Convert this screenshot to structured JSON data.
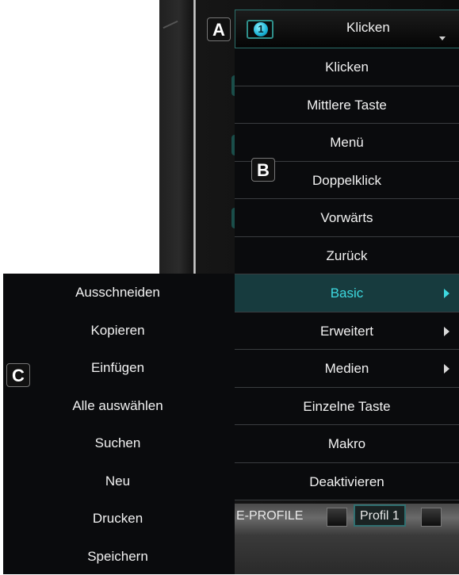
{
  "callouts": {
    "a": "A",
    "b": "B",
    "c": "C"
  },
  "dropdown": {
    "badge": "1",
    "selected_value": "Klicken",
    "items": [
      {
        "label": "Klicken",
        "has_submenu": false
      },
      {
        "label": "Mittlere Taste",
        "has_submenu": false
      },
      {
        "label": "Menü",
        "has_submenu": false
      },
      {
        "label": "Doppelklick",
        "has_submenu": false
      },
      {
        "label": "Vorwärts",
        "has_submenu": false
      },
      {
        "label": "Zurück",
        "has_submenu": false
      },
      {
        "label": "Basic",
        "has_submenu": true,
        "active": true
      },
      {
        "label": "Erweitert",
        "has_submenu": true
      },
      {
        "label": "Medien",
        "has_submenu": true
      },
      {
        "label": "Einzelne Taste",
        "has_submenu": false
      },
      {
        "label": "Makro",
        "has_submenu": false
      },
      {
        "label": "Deaktivieren",
        "has_submenu": false
      }
    ]
  },
  "submenu": {
    "items": [
      {
        "label": "Ausschneiden"
      },
      {
        "label": "Kopieren"
      },
      {
        "label": "Einfügen"
      },
      {
        "label": "Alle auswählen"
      },
      {
        "label": "Suchen"
      },
      {
        "label": "Neu"
      },
      {
        "label": "Drucken"
      },
      {
        "label": "Speichern"
      }
    ]
  },
  "tabs": {
    "eprofile": "E-PROFILE",
    "profil": "Profil 1"
  },
  "colors": {
    "accent": "#3dd9e0",
    "active_bg": "#173b3e",
    "menu_bg": "#0a0b0d"
  }
}
